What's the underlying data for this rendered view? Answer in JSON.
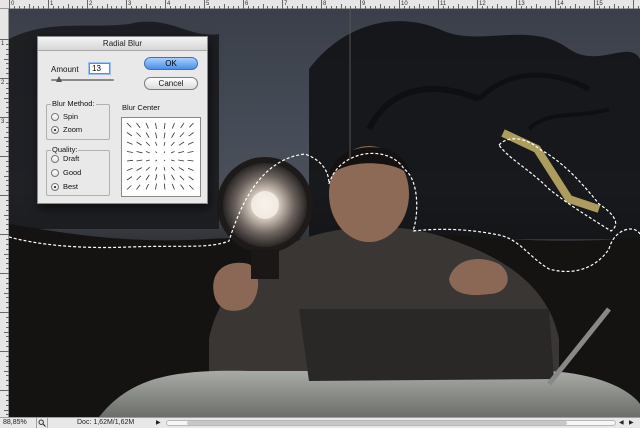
{
  "rulers": {
    "top_labels": [
      "0",
      "1",
      "2",
      "3",
      "4",
      "5",
      "6",
      "7",
      "8",
      "9",
      "10",
      "11",
      "12",
      "13",
      "14",
      "15"
    ],
    "left_labels": [
      "1",
      "2",
      "3"
    ]
  },
  "dialog": {
    "title": "Radial Blur",
    "amount_label": "Amount",
    "amount_value": "13",
    "amount_slider_fraction": 0.13,
    "ok_label": "OK",
    "cancel_label": "Cancel",
    "blur_method": {
      "title": "Blur Method:",
      "options": [
        "Spin",
        "Zoom"
      ],
      "selected": "Zoom"
    },
    "quality": {
      "title": "Quality:",
      "options": [
        "Draft",
        "Good",
        "Best"
      ],
      "selected": "Best"
    },
    "blur_center_label": "Blur Center"
  },
  "statusbar": {
    "zoom": "88,85%",
    "doc": "Doc: 1,62M/1,62M",
    "arrow": "▶"
  },
  "icons": {
    "zoom_box": "magnifier-icon",
    "doc_menu": "triangle-right-icon"
  },
  "colors": {
    "ok_button": "#4b8fe6",
    "selection_marquee": "#ffffff"
  }
}
